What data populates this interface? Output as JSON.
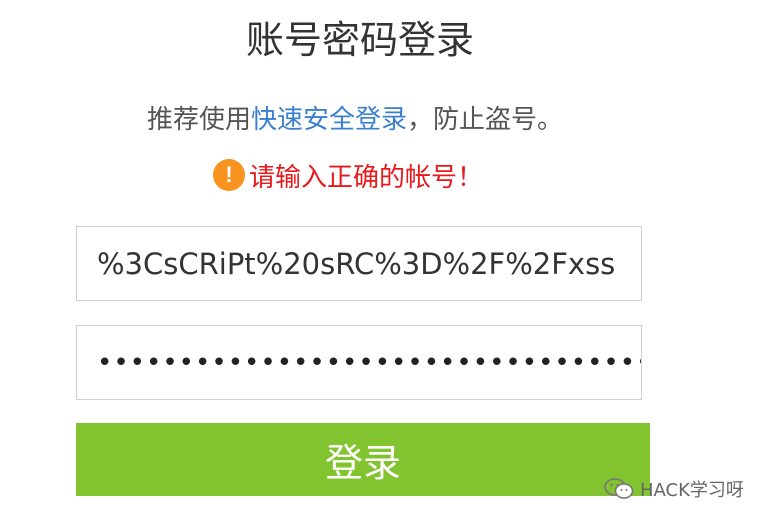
{
  "title": "账号密码登录",
  "hint": {
    "prefix": "推荐使用",
    "link": "快速安全登录",
    "suffix": "，防止盗号。"
  },
  "error": {
    "icon_glyph": "!",
    "icon_name": "warning-icon",
    "message": "请输入正确的帐号！",
    "color": "#e8191c"
  },
  "username": {
    "value": "%3CsCRiPt%20sRC%3D%2F%2Fxss"
  },
  "password": {
    "masked": "••••••••••••••••••••••••••••••••••••"
  },
  "login_button": {
    "label": "登录",
    "color": "#82c42f"
  },
  "watermark": {
    "text": "HACK学习呀",
    "icon_name": "wechat-icon"
  }
}
